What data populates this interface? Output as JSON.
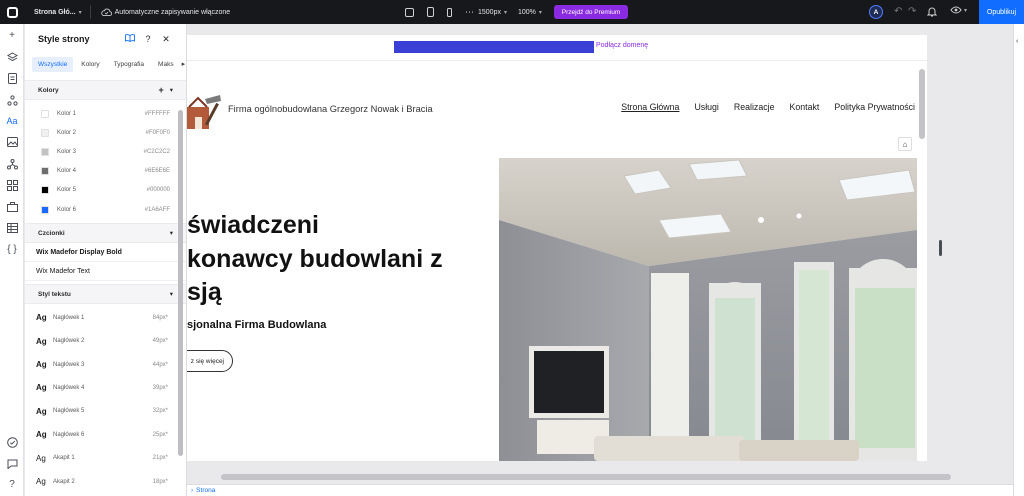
{
  "topbar": {
    "site_name": "Strona Głó...",
    "autosave": "Automatyczne zapisywanie włączone",
    "width_value": "1500px",
    "zoom_value": "100%",
    "premium_label": "Przejdź do Premium",
    "avatar_initial": "A",
    "publish_label": "Opublikuj"
  },
  "panel": {
    "title": "Style strony",
    "tabs": [
      "Wszystkie",
      "Kolory",
      "Typografia",
      "Maks"
    ],
    "colors_title": "Kolory",
    "colors": [
      {
        "label": "Kolor 1",
        "hex": "#FFFFFF",
        "swatch": "#FFFFFF"
      },
      {
        "label": "Kolor 2",
        "hex": "#F0F0F0",
        "swatch": "#F0F0F0"
      },
      {
        "label": "Kolor 3",
        "hex": "#C2C2C2",
        "swatch": "#C2C2C2"
      },
      {
        "label": "Kolor 4",
        "hex": "#6E6E6E",
        "swatch": "#6E6E6E"
      },
      {
        "label": "Kolor 5",
        "hex": "#000000",
        "swatch": "#000000"
      },
      {
        "label": "Kolor 6",
        "hex": "#1A6AFF",
        "swatch": "#1A6AFF"
      }
    ],
    "fonts_title": "Czcionki",
    "fonts": [
      "Wix Madefor Display Bold",
      "Wix Madefor Text"
    ],
    "text_styles_title": "Styl tekstu",
    "text_styles": [
      {
        "ag": "Ag",
        "label": "Nagłówek 1",
        "size": "84px*"
      },
      {
        "ag": "Ag",
        "label": "Nagłówek 2",
        "size": "49px*"
      },
      {
        "ag": "Ag",
        "label": "Nagłówek 3",
        "size": "44px*"
      },
      {
        "ag": "Ag",
        "label": "Nagłówek 4",
        "size": "39px*"
      },
      {
        "ag": "Ag",
        "label": "Nagłówek 5",
        "size": "32px*"
      },
      {
        "ag": "Ag",
        "label": "Nagłówek 6",
        "size": "25px*"
      },
      {
        "ag": "Ag",
        "label": "Akapit 1",
        "size": "21px*"
      },
      {
        "ag": "Ag",
        "label": "Akapit 2",
        "size": "18px*"
      }
    ]
  },
  "canvas": {
    "domain_link": "Podłącz domenę",
    "brand": "Firma ogólnobudowlana Grzegorz Nowak i Bracia",
    "nav": [
      "Strona Główna",
      "Usługi",
      "Realizacje",
      "Kontakt",
      "Polityka Prywatności"
    ],
    "hero_line1": "świadczeni",
    "hero_line2": "konawcy budowlani z",
    "hero_line3": "sją",
    "hero_sub": "sjonalna Firma Budowlana",
    "hero_button": "z się więcej"
  },
  "footer": {
    "breadcrumb": "Strona"
  },
  "accents": {
    "brand_blue": "#116dff",
    "premium_purple": "#8a2be2",
    "topbar_bg": "#17181c"
  }
}
